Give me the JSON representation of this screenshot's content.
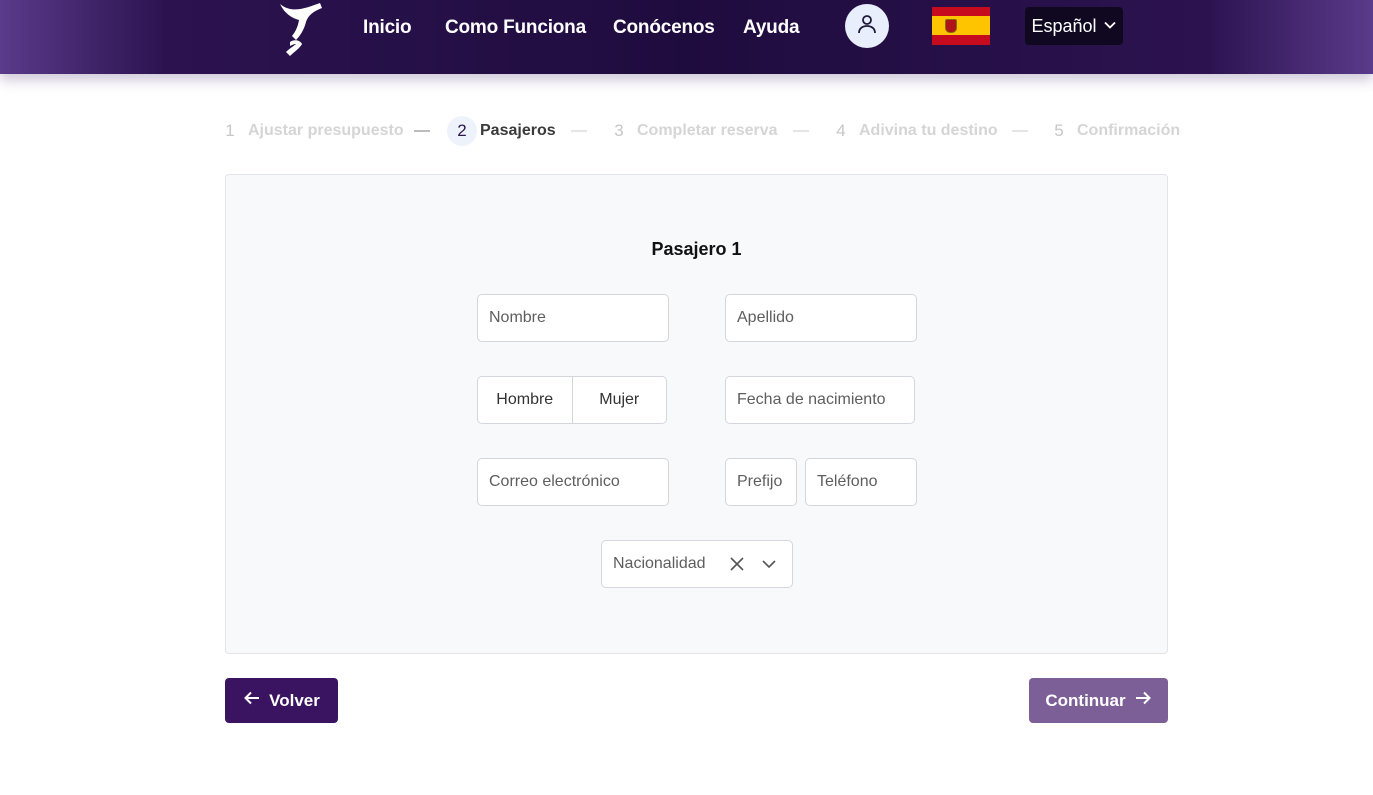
{
  "header": {
    "nav": [
      "Inicio",
      "Como Funciona",
      "Conócenos",
      "Ayuda"
    ],
    "language": "Español",
    "icons": {
      "logo": "brand-logo",
      "user": "user-icon",
      "flag": "spain-flag-icon",
      "dropdown": "chevron-down-icon"
    }
  },
  "stepper": {
    "steps": [
      {
        "num": "1",
        "label": "Ajustar presupuesto"
      },
      {
        "num": "2",
        "label": "Pasajeros"
      },
      {
        "num": "3",
        "label": "Completar reserva"
      },
      {
        "num": "4",
        "label": "Adivina tu destino"
      },
      {
        "num": "5",
        "label": "Confirmación"
      }
    ],
    "active_step": 2
  },
  "form": {
    "title": "Pasajero 1",
    "nombre_placeholder": "Nombre",
    "apellido_placeholder": "Apellido",
    "gender_options": [
      "Hombre",
      "Mujer"
    ],
    "fecha_placeholder": "Fecha de nacimiento",
    "correo_placeholder": "Correo electrónico",
    "prefijo_placeholder": "Prefijo",
    "telefono_placeholder": "Teléfono",
    "nacionalidad_placeholder": "Nacionalidad"
  },
  "actions": {
    "back_label": "Volver",
    "continue_label": "Continuar"
  },
  "colors": {
    "header": "#1f0c3e",
    "back_button": "#3a1460",
    "continue_button": "#7d5f97",
    "card_bg": "#f8f9fb"
  }
}
